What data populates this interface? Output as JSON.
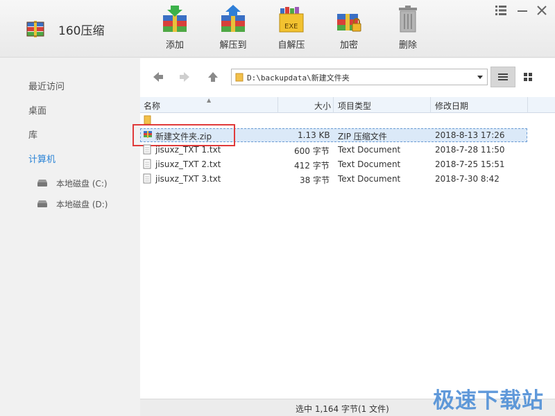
{
  "app": {
    "title": "160压缩"
  },
  "toolbar": {
    "add": "添加",
    "extract_to": "解压到",
    "self_extract": "自解压",
    "encrypt": "加密",
    "delete": "删除",
    "exe_badge": "EXE"
  },
  "sidebar": {
    "items": [
      "最近访问",
      "桌面",
      "库",
      "计算机"
    ],
    "active": "计算机",
    "drives": [
      "本地磁盘 (C:)",
      "本地磁盘 (D:)"
    ]
  },
  "path": {
    "value": "D:\\backupdata\\新建文件夹"
  },
  "columns": {
    "name": "名称",
    "size": "大小",
    "type": "项目类型",
    "modified": "修改日期"
  },
  "files": [
    {
      "name": "新建文件夹.zip",
      "size": "1.13 KB",
      "type": "ZIP 压缩文件",
      "modified": "2018-8-13 17:26"
    },
    {
      "name": "jisuxz_TXT 1.txt",
      "size": "600 字节",
      "type": "Text Document",
      "modified": "2018-7-28 11:50"
    },
    {
      "name": "jisuxz_TXT 2.txt",
      "size": "412 字节",
      "type": "Text Document",
      "modified": "2018-7-25 15:51"
    },
    {
      "name": "jisuxz_TXT 3.txt",
      "size": "38 字节",
      "type": "Text Document",
      "modified": "2018-7-30 8:42"
    }
  ],
  "status": {
    "text": "选中 1,164 字节(1 文件)"
  },
  "watermark": "极速下载站",
  "colors": {
    "accent": "#2c84d6",
    "highlight": "#e03a3a",
    "selection": "#dbe9f8"
  }
}
